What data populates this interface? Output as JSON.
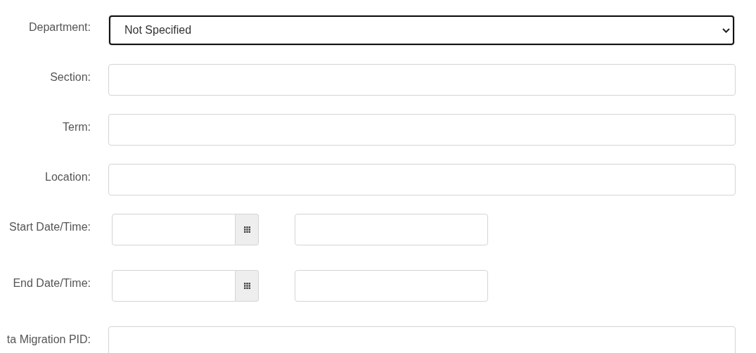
{
  "fields": [
    {
      "kind": "select",
      "label": "Department:",
      "value": "Not Specified",
      "focused": true
    },
    {
      "kind": "text",
      "label": "Section:",
      "focused": false
    },
    {
      "kind": "text",
      "label": "Term:",
      "focused": false
    },
    {
      "kind": "text",
      "label": "Location:",
      "focused": false
    },
    {
      "kind": "datetime",
      "label": "Start Date/Time:",
      "focused": false
    },
    {
      "kind": "datetime",
      "label": "End Date/Time:",
      "focused": false
    },
    {
      "kind": "text",
      "label": "ta Migration PID:",
      "focused": false
    }
  ]
}
